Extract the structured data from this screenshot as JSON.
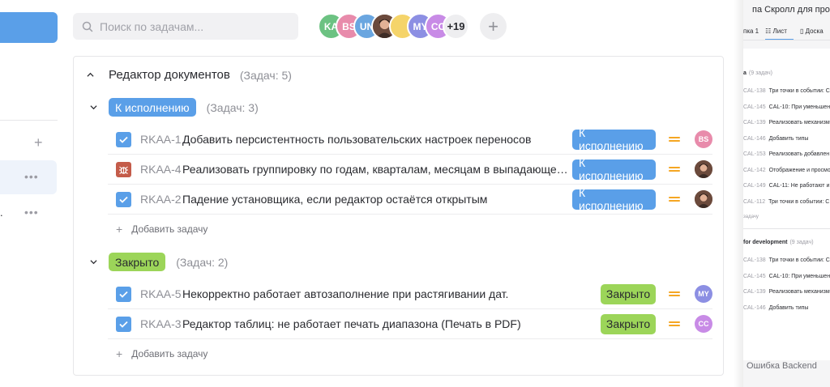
{
  "search": {
    "placeholder": "Поиск по задачам..."
  },
  "members": {
    "avatars": [
      {
        "initials": "KA",
        "color": "#6cc282"
      },
      {
        "initials": "BS",
        "color": "#e88bab"
      },
      {
        "initials": "UN",
        "color": "#6aa6e0"
      },
      {
        "initials": "",
        "color": "#8b5e4a",
        "photo": true
      },
      {
        "initials": "",
        "color": "#f5d46a"
      },
      {
        "initials": "MY",
        "color": "#8c8fe3"
      },
      {
        "initials": "CC",
        "color": "#c88be6"
      }
    ],
    "more_count": "+19"
  },
  "project": {
    "title": "Редактор документов",
    "count_label": "(Задач: 5)",
    "groups": [
      {
        "status": "К исполнению",
        "status_color": "#5a9fe8",
        "count_label": "(Задач: 3)",
        "tasks": [
          {
            "id": "RKAA-1",
            "type": "task",
            "title": "Добавить персистентность пользовательских настроек переносов",
            "status": "К исполнению",
            "priority": "medium",
            "assignee": {
              "initials": "BS",
              "color": "#e88bab"
            }
          },
          {
            "id": "RKAA-4",
            "type": "bug",
            "title": "Реализовать группировку по годам, кварталам, месяцам в выпадающем ...",
            "status": "К исполнению",
            "priority": "medium",
            "assignee": {
              "initials": "",
              "color": "#8b5e4a",
              "photo": true
            }
          },
          {
            "id": "RKAA-2",
            "type": "task",
            "title": "Падение установщика, если редактор остаётся открытым",
            "status": "К исполнению",
            "priority": "medium",
            "assignee": {
              "initials": "",
              "color": "#8b5e4a",
              "photo": true
            }
          }
        ],
        "add_label": "Добавить задачу"
      },
      {
        "status": "Закрыто",
        "status_color": "#9cd559",
        "count_label": "(Задач: 2)",
        "tasks": [
          {
            "id": "RKAA-5",
            "type": "task",
            "title": "Некорректно работает автозаполнение при растягивании дат.",
            "status": "Закрыто",
            "priority": "medium",
            "assignee": {
              "initials": "MY",
              "color": "#8c8fe3"
            }
          },
          {
            "id": "RKAA-3",
            "type": "task",
            "title": "Редактор таблиц: не работает печать диапазона (Печать в PDF)",
            "status": "Закрыто",
            "priority": "medium",
            "assignee": {
              "initials": "CC",
              "color": "#c88be6"
            }
          }
        ],
        "add_label": "Добавить задачу"
      }
    ]
  },
  "sidebar": {
    "fragment": "."
  },
  "side_panel": {
    "title": "па Скролл для проект",
    "tabs": [
      "пка 1",
      "Лист",
      "Доска"
    ],
    "group1": {
      "name": "а",
      "count": "(9 задач)"
    },
    "group1_rows": [
      {
        "id": "CAL-138",
        "title": "Три точки в событии: С"
      },
      {
        "id": "CAL-145",
        "title": "CAL-10: При уменьшени"
      },
      {
        "id": "CAL-139",
        "title": "Реализовать механизм"
      },
      {
        "id": "CAL-146",
        "title": "Добавить типы"
      },
      {
        "id": "CAL-153",
        "title": "Реализовать добавлен"
      },
      {
        "id": "CAL-142",
        "title": "Отображение и просмо"
      },
      {
        "id": "CAL-149",
        "title": "CAL-11: Не работают и"
      },
      {
        "id": "CAL-112",
        "title": "Три точки в событии: С"
      }
    ],
    "add_small": "задачу",
    "group2": {
      "name": "for development",
      "count": "(9 задач)"
    },
    "group2_rows": [
      {
        "id": "CAL-138",
        "title": "Три точки в событии: С"
      },
      {
        "id": "CAL-145",
        "title": "CAL-10: При уменьшени"
      },
      {
        "id": "CAL-139",
        "title": "Реализовать механизм"
      },
      {
        "id": "CAL-146",
        "title": "Добавить типы"
      }
    ],
    "footer": "Ошибка Backend"
  }
}
